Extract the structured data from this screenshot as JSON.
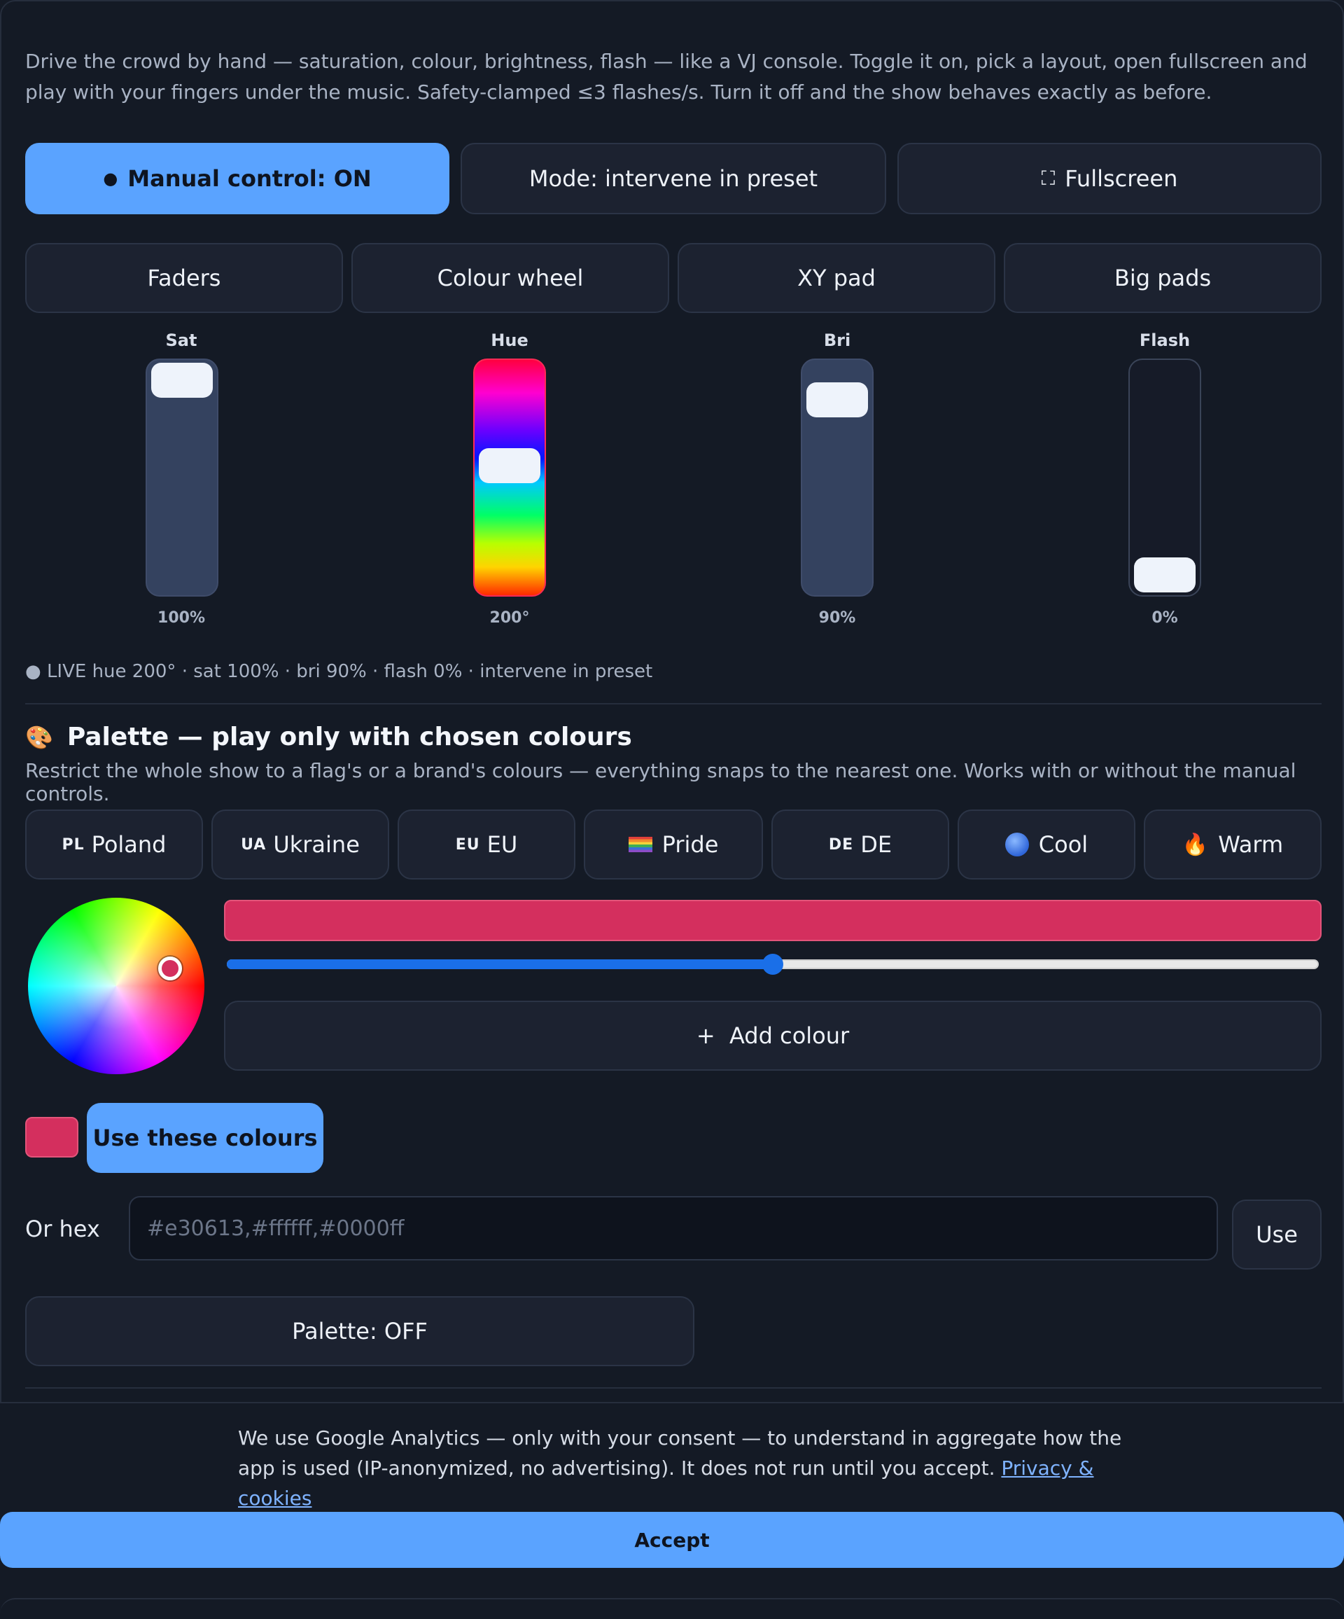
{
  "intro": "Drive the crowd by hand — saturation, colour, brightness, flash — like a VJ console. Toggle it on, pick a layout, open fullscreen and play with your fingers under the music. Safety-clamped ≤3 flashes/s. Turn it off and the show behaves exactly as before.",
  "controls": {
    "manual_dot": "●",
    "manual_label": "Manual control: ON",
    "mode_label": "Mode: intervene in preset",
    "fullscreen_icon": "⛶",
    "fullscreen_label": "Fullscreen"
  },
  "layouts": [
    "Faders",
    "Colour wheel",
    "XY pad",
    "Big pads"
  ],
  "faders": [
    {
      "label": "Sat",
      "value": "100%",
      "level": 1.0
    },
    {
      "label": "Hue",
      "value": "200°",
      "level": 0.56
    },
    {
      "label": "Bri",
      "value": "90%",
      "level": 0.9
    },
    {
      "label": "Flash",
      "value": "0%",
      "level": 0.0
    }
  ],
  "live_status": "● LIVE hue 200° · sat 100% · bri 90% · flash 0% · intervene in preset",
  "palette": {
    "title_icon": "🎨",
    "title": "Palette — play only with chosen colours",
    "description": "Restrict the whole show to a flag's or a brand's colours — everything snaps to the nearest one. Works with or without the manual controls.",
    "presets": [
      {
        "flag": "PL",
        "label": "Poland",
        "icon": "flag"
      },
      {
        "flag": "UA",
        "label": "Ukraine",
        "icon": "flag"
      },
      {
        "flag": "EU",
        "label": "EU",
        "icon": "flag"
      },
      {
        "flag": "",
        "label": "Pride",
        "icon": "rainbow-flag-icon"
      },
      {
        "flag": "DE",
        "label": "DE",
        "icon": "flag"
      },
      {
        "flag": "",
        "label": "Cool",
        "icon": "blue-circle-icon"
      },
      {
        "flag": "",
        "label": "Warm",
        "icon": "flame-icon"
      }
    ],
    "current_color": "#d42f5e",
    "slider_value": 0.5,
    "add_colour_label": "+  Add colour",
    "use_colours_label": "Use these colours",
    "hex_label": "Or hex",
    "hex_placeholder": "#e30613,#ffffff,#0000ff",
    "hex_use_label": "Use",
    "toggle_label": "Palette: OFF"
  },
  "consent": {
    "text": "We use Google Analytics — only with your consent — to understand in aggregate how the app is used (IP-anonymized, no advertising). It does not run until you accept. ",
    "link": "Privacy & cookies",
    "accept_label": "Accept"
  },
  "colors": {
    "accent": "#5aa3ff",
    "background": "#141a25",
    "palette_color": "#d42f5e",
    "slider_blue": "#1a6fe8"
  }
}
